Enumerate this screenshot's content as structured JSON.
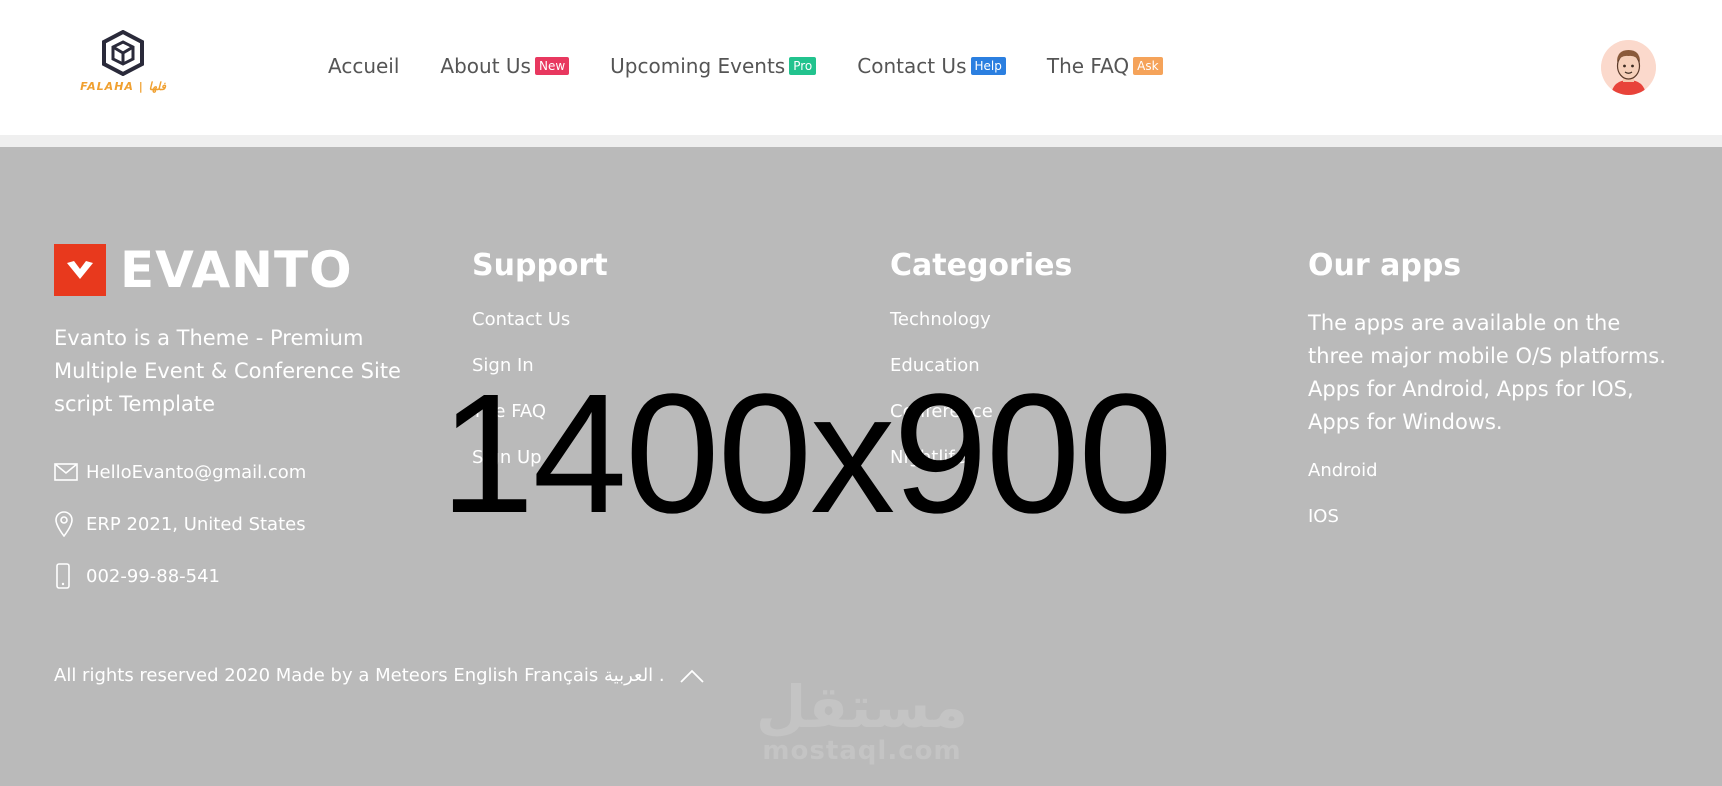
{
  "header": {
    "logo": {
      "text": "FALAHA | فلها",
      "icon": "cube-logo-icon"
    },
    "nav": [
      {
        "label": "Accueil"
      },
      {
        "label": "About Us",
        "badge": "New",
        "badge_color": "#e8385f"
      },
      {
        "label": "Upcoming Events",
        "badge": "Pro",
        "badge_color": "#22c38e"
      },
      {
        "label": "Contact Us",
        "badge": "Help",
        "badge_color": "#2b7fe0"
      },
      {
        "label": "The FAQ",
        "badge": "Ask",
        "badge_color": "#f5a35a"
      }
    ],
    "avatar_icon": "user-avatar-icon"
  },
  "footer": {
    "brand": {
      "name": "EVANTO",
      "color": "#e8391d"
    },
    "about_text": "Evanto is a Theme - Premium Multiple Event & Conference Site script Template",
    "contacts": [
      {
        "icon": "mail-icon",
        "text": "HelloEvanto@gmail.com"
      },
      {
        "icon": "location-pin-icon",
        "text": "ERP 2021, United States"
      },
      {
        "icon": "mobile-phone-icon",
        "text": "002-99-88-541"
      }
    ],
    "support": {
      "title": "Support",
      "links": [
        "Contact Us",
        "Sign In",
        "The FAQ",
        "Sign Up"
      ]
    },
    "categories": {
      "title": "Categories",
      "links": [
        "Technology",
        "Education",
        "Conference",
        "Nightlife"
      ]
    },
    "apps": {
      "title": "Our apps",
      "text": "The apps are available on the three major mobile O/S platforms. Apps for Android, Apps for IOS, Apps for Windows.",
      "links": [
        "Android",
        "IOS"
      ]
    },
    "placeholder_text": "1400x900",
    "copyright": "All rights reserved 2020 Made by a Meteors English Français العربية .",
    "watermark": {
      "arabic": "مستقل",
      "latin": "mostaql.com"
    },
    "background": "#bababa"
  }
}
